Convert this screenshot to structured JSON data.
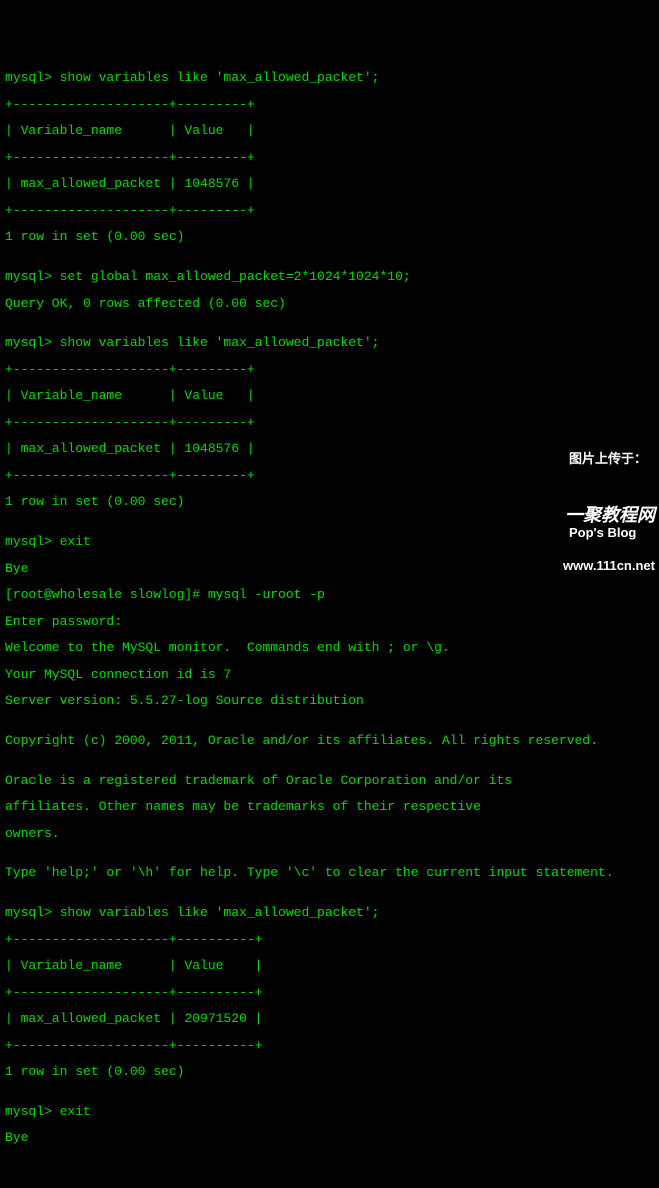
{
  "lines": [
    "mysql> show variables like 'max_allowed_packet';",
    "+--------------------+---------+",
    "| Variable_name      | Value   |",
    "+--------------------+---------+",
    "| max_allowed_packet | 1048576 |",
    "+--------------------+---------+",
    "1 row in set (0.00 sec)",
    "",
    "mysql> set global max_allowed_packet=2*1024*1024*10;",
    "Query OK, 0 rows affected (0.00 sec)",
    "",
    "mysql> show variables like 'max_allowed_packet';",
    "+--------------------+---------+",
    "| Variable_name      | Value   |",
    "+--------------------+---------+",
    "| max_allowed_packet | 1048576 |",
    "+--------------------+---------+",
    "1 row in set (0.00 sec)",
    "",
    "mysql> exit",
    "Bye",
    "[root@wholesale slowlog]# mysql -uroot -p",
    "Enter password:",
    "Welcome to the MySQL monitor.  Commands end with ; or \\g.",
    "Your MySQL connection id is 7",
    "Server version: 5.5.27-log Source distribution",
    "",
    "Copyright (c) 2000, 2011, Oracle and/or its affiliates. All rights reserved.",
    "",
    "Oracle is a registered trademark of Oracle Corporation and/or its",
    "affiliates. Other names may be trademarks of their respective",
    "owners.",
    "",
    "Type 'help;' or '\\h' for help. Type '\\c' to clear the current input statement.",
    "",
    "mysql> show variables like 'max_allowed_packet';",
    "+--------------------+----------+",
    "| Variable_name      | Value    |",
    "+--------------------+----------+",
    "| max_allowed_packet | 20971520 |",
    "+--------------------+----------+",
    "1 row in set (0.00 sec)",
    "",
    "mysql> exit",
    "Bye"
  ],
  "overlay": {
    "upload_text": "图片上传于：",
    "blog_text": "Pop's Blog"
  },
  "watermark": {
    "site": "一聚教程网",
    "url": "www.111cn.net"
  }
}
